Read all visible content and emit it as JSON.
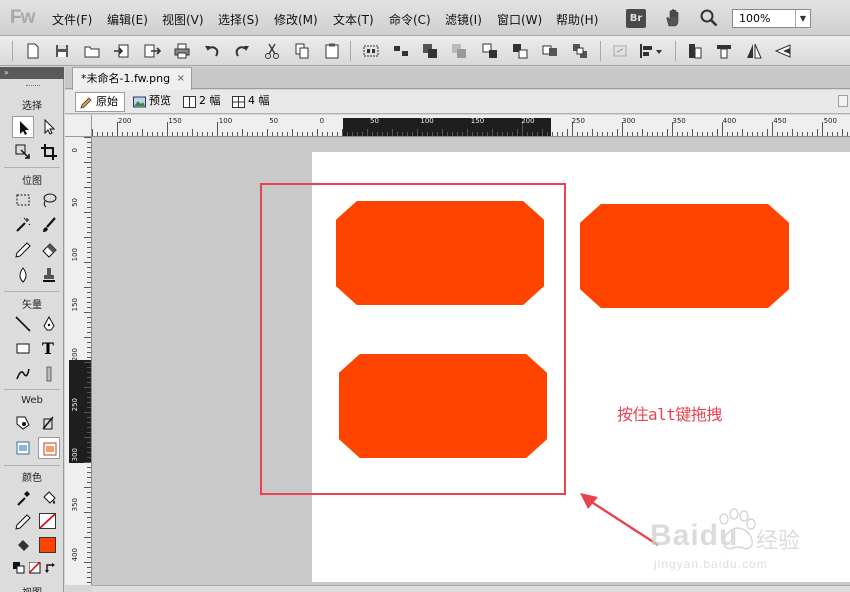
{
  "app": {
    "logo": "Fw"
  },
  "menu": [
    "文件(F)",
    "编辑(E)",
    "视图(V)",
    "选择(S)",
    "修改(M)",
    "文本(T)",
    "命令(C)",
    "滤镜(I)",
    "窗口(W)",
    "帮助(H)"
  ],
  "bridge_label": "Br",
  "zoom": {
    "value": "100%"
  },
  "document": {
    "tab_label": "*未命名-1.fw.png",
    "close_glyph": "×"
  },
  "view_tabs": [
    {
      "label": "原始",
      "icon": "pencil-icon"
    },
    {
      "label": "预览",
      "icon": "image-icon"
    },
    {
      "label": "2 幅",
      "icon": "two-up-icon"
    },
    {
      "label": "4 幅",
      "icon": "four-up-icon"
    }
  ],
  "tools": {
    "collapse_glyph": "»",
    "sections": [
      "选择",
      "位图",
      "矢量",
      "Web",
      "颜色",
      "视图"
    ],
    "text_tool_glyph": "T",
    "stroke_color": "#222222",
    "fill_color": "#ff4400"
  },
  "rulers": {
    "h_labels": [
      "200",
      "150",
      "100",
      "50",
      "0",
      "50",
      "100",
      "150",
      "200",
      "250",
      "300",
      "350",
      "400",
      "450",
      "500"
    ],
    "v_labels": [
      "0",
      "50",
      "100",
      "150",
      "200",
      "250",
      "300",
      "350",
      "400"
    ]
  },
  "canvas": {
    "shape_color": "#ff4400",
    "selection_color": "#e8434f",
    "annotation": "按住alt键拖拽"
  },
  "watermark": {
    "brand": "Baidu",
    "brand_cn": "经验",
    "url": "jingyan.baidu.com"
  }
}
